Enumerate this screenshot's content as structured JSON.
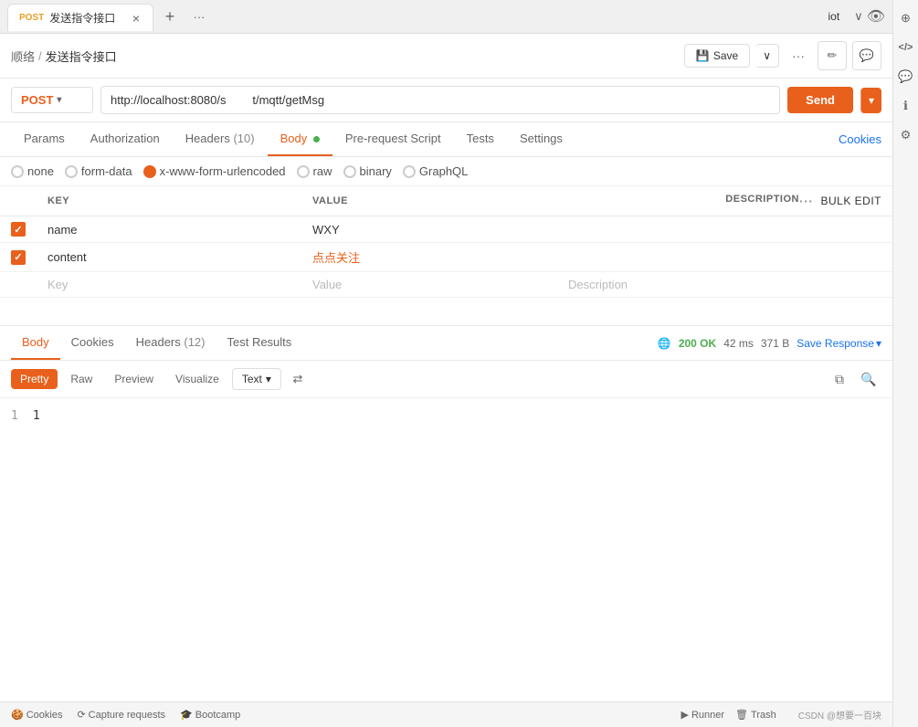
{
  "browser": {
    "tab_method": "POST",
    "tab_title": "发送指令接口",
    "tab_close": "×",
    "tab_new": "+",
    "tab_more": "···",
    "tab_iot": "iot",
    "tab_dropdown": "∨",
    "tab_eye": "👁"
  },
  "toolbar": {
    "breadcrumb_root": "顺络",
    "breadcrumb_sep": "/",
    "breadcrumb_current": "发送指令接口",
    "save_label": "Save",
    "more_label": "···",
    "edit_icon": "✏",
    "comment_icon": "💬"
  },
  "request": {
    "method": "POST",
    "url": "http://localhost:8080/s        t/mqtt/getMsg",
    "send_label": "Send"
  },
  "tabs": {
    "items": [
      {
        "label": "Params",
        "active": false
      },
      {
        "label": "Authorization",
        "active": false
      },
      {
        "label": "Headers",
        "badge": "(10)",
        "active": false
      },
      {
        "label": "Body",
        "dot": true,
        "active": true
      },
      {
        "label": "Pre-request Script",
        "active": false
      },
      {
        "label": "Tests",
        "active": false
      },
      {
        "label": "Settings",
        "active": false
      }
    ],
    "cookies_link": "Cookies"
  },
  "body_types": [
    {
      "id": "none",
      "label": "none",
      "checked": false
    },
    {
      "id": "form-data",
      "label": "form-data",
      "checked": false
    },
    {
      "id": "x-www-form-urlencoded",
      "label": "x-www-form-urlencoded",
      "checked": true
    },
    {
      "id": "raw",
      "label": "raw",
      "checked": false
    },
    {
      "id": "binary",
      "label": "binary",
      "checked": false
    },
    {
      "id": "graphql",
      "label": "GraphQL",
      "checked": false
    }
  ],
  "table": {
    "headers": {
      "check": "",
      "key": "KEY",
      "value": "VALUE",
      "description": "DESCRIPTION",
      "more": "···",
      "bulk_edit": "Bulk Edit"
    },
    "rows": [
      {
        "checked": true,
        "key": "name",
        "value": "WXY",
        "description": "",
        "value_color": "normal"
      },
      {
        "checked": true,
        "key": "content",
        "value": "点点关注",
        "description": "",
        "value_color": "red"
      }
    ],
    "empty_row": {
      "key_placeholder": "Key",
      "value_placeholder": "Value",
      "desc_placeholder": "Description"
    }
  },
  "response": {
    "tabs": [
      {
        "label": "Body",
        "active": true
      },
      {
        "label": "Cookies",
        "active": false
      },
      {
        "label": "Headers",
        "badge": "(12)",
        "active": false
      },
      {
        "label": "Test Results",
        "active": false
      }
    ],
    "status": {
      "globe": "🌐",
      "code": "200 OK",
      "time": "42 ms",
      "size": "371 B"
    },
    "save_response": "Save Response",
    "format_btns": [
      {
        "label": "Pretty",
        "active": true
      },
      {
        "label": "Raw",
        "active": false
      },
      {
        "label": "Preview",
        "active": false
      },
      {
        "label": "Visualize",
        "active": false
      }
    ],
    "text_format": "Text",
    "wrap_icon": "≡",
    "copy_icon": "⧉",
    "search_icon": "🔍",
    "line1": "1",
    "content": "1"
  },
  "bottom_bar": {
    "cookies_label": "Cookies",
    "capture_label": "Capture requests",
    "bootcamp_label": "Bootcamp",
    "runner_label": "Runner",
    "trash_label": "Trash",
    "watermark": "CSDN @想要一百块"
  },
  "right_sidebar": {
    "icons": [
      "⊕",
      "</>",
      "💬",
      "ℹ",
      "⚙"
    ]
  }
}
